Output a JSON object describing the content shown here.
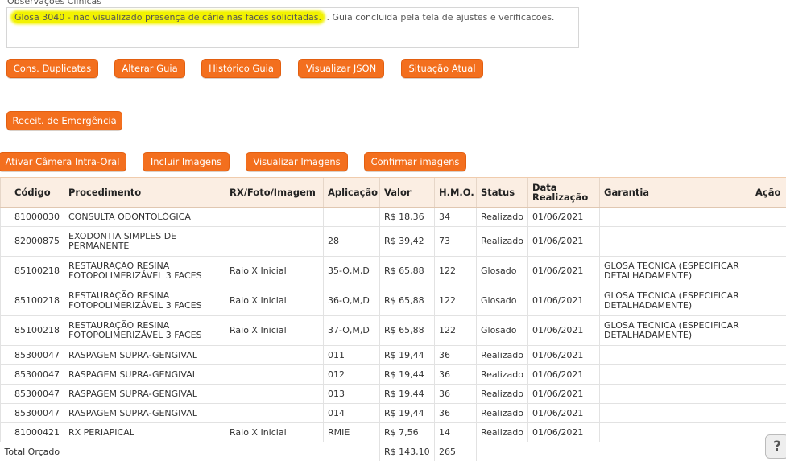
{
  "observations": {
    "label": "Observações Clínicas",
    "highlighted_text": "Glosa 3040 - não visualizado presença de cárie nas faces solicitadas.",
    "rest_text": " . Guia concluida pela tela de ajustes e verificacoes."
  },
  "buttons_row1": {
    "duplicates": "Cons. Duplicatas",
    "alter": "Alterar Guia",
    "history": "Histórico Guia",
    "json": "Visualizar JSON",
    "status": "Situação Atual"
  },
  "buttons_row2": {
    "emergency": "Receit. de Emergência"
  },
  "buttons_row3": {
    "camera": "Ativar Câmera Intra-Oral",
    "include": "Incluir Imagens",
    "view": "Visualizar Imagens",
    "confirm": "Confirmar imagens"
  },
  "table": {
    "headers": {
      "codigo": "Código",
      "procedimento": "Procedimento",
      "rx": "RX/Foto/Imagem",
      "aplicacao": "Aplicação",
      "valor": "Valor",
      "hmo": "H.M.O.",
      "status": "Status",
      "data": "Data Realização",
      "garantia": "Garantia",
      "acao": "Ação"
    },
    "rows": [
      {
        "codigo": "81000030",
        "procedimento": "CONSULTA ODONTOLÓGICA",
        "rx": "",
        "aplicacao": "",
        "valor": "R$ 18,36",
        "hmo": "34",
        "status": "Realizado",
        "data": "01/06/2021",
        "garantia": ""
      },
      {
        "codigo": "82000875",
        "procedimento": "EXODONTIA SIMPLES DE PERMANENTE",
        "rx": "",
        "aplicacao": "28",
        "valor": "R$ 39,42",
        "hmo": "73",
        "status": "Realizado",
        "data": "01/06/2021",
        "garantia": ""
      },
      {
        "codigo": "85100218",
        "procedimento": "RESTAURAÇÃO RESINA FOTOPOLIMERIZÁVEL 3 FACES",
        "rx": "Raio X Inicial",
        "aplicacao": "35-O,M,D",
        "valor": "R$ 65,88",
        "hmo": "122",
        "status": "Glosado",
        "data": "01/06/2021",
        "garantia": "GLOSA TECNICA (ESPECIFICAR DETALHADAMENTE)"
      },
      {
        "codigo": "85100218",
        "procedimento": "RESTAURAÇÃO RESINA FOTOPOLIMERIZÁVEL 3 FACES",
        "rx": "Raio X Inicial",
        "aplicacao": "36-O,M,D",
        "valor": "R$ 65,88",
        "hmo": "122",
        "status": "Glosado",
        "data": "01/06/2021",
        "garantia": "GLOSA TECNICA (ESPECIFICAR DETALHADAMENTE)"
      },
      {
        "codigo": "85100218",
        "procedimento": "RESTAURAÇÃO RESINA FOTOPOLIMERIZÁVEL 3 FACES",
        "rx": "Raio X Inicial",
        "aplicacao": "37-O,M,D",
        "valor": "R$ 65,88",
        "hmo": "122",
        "status": "Glosado",
        "data": "01/06/2021",
        "garantia": "GLOSA TECNICA (ESPECIFICAR DETALHADAMENTE)"
      },
      {
        "codigo": "85300047",
        "procedimento": "RASPAGEM SUPRA-GENGIVAL",
        "rx": "",
        "aplicacao": "011",
        "valor": "R$ 19,44",
        "hmo": "36",
        "status": "Realizado",
        "data": "01/06/2021",
        "garantia": ""
      },
      {
        "codigo": "85300047",
        "procedimento": "RASPAGEM SUPRA-GENGIVAL",
        "rx": "",
        "aplicacao": "012",
        "valor": "R$ 19,44",
        "hmo": "36",
        "status": "Realizado",
        "data": "01/06/2021",
        "garantia": ""
      },
      {
        "codigo": "85300047",
        "procedimento": "RASPAGEM SUPRA-GENGIVAL",
        "rx": "",
        "aplicacao": "013",
        "valor": "R$ 19,44",
        "hmo": "36",
        "status": "Realizado",
        "data": "01/06/2021",
        "garantia": ""
      },
      {
        "codigo": "85300047",
        "procedimento": "RASPAGEM SUPRA-GENGIVAL",
        "rx": "",
        "aplicacao": "014",
        "valor": "R$ 19,44",
        "hmo": "36",
        "status": "Realizado",
        "data": "01/06/2021",
        "garantia": ""
      },
      {
        "codigo": "81000421",
        "procedimento": "RX PERIAPICAL",
        "rx": "Raio X Inicial",
        "aplicacao": "RMIE",
        "valor": "R$ 7,56",
        "hmo": "14",
        "status": "Realizado",
        "data": "01/06/2021",
        "garantia": ""
      }
    ],
    "total": {
      "label": "Total Orçado",
      "valor": "R$ 143,10",
      "hmo": "265"
    }
  },
  "help": {
    "label": "?"
  },
  "colors": {
    "accent": "#f36f1e",
    "header_bg": "#fbeee3",
    "highlight": "#f2f200"
  }
}
